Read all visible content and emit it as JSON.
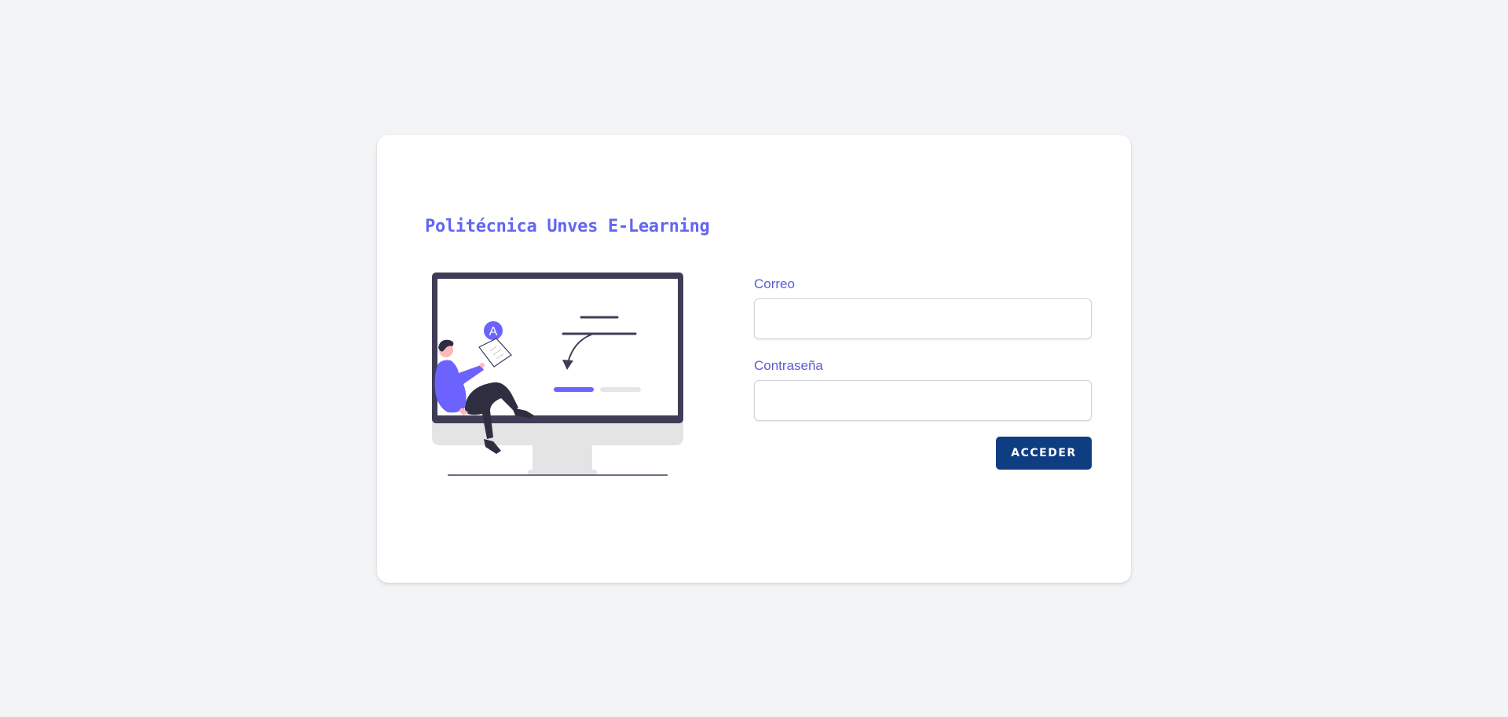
{
  "brand": {
    "title": "Politécnica Unves E-Learning"
  },
  "illustration": {
    "name": "online-learning-illustration",
    "badge_letter": "A"
  },
  "form": {
    "email_label": "Correo",
    "email_value": "",
    "password_label": "Contraseña",
    "password_value": "",
    "submit_label": "ACCEDER"
  },
  "colors": {
    "page_background": "#f3f4f6",
    "accent": "#6366f1",
    "button": "#0f3d82",
    "monitor_frame": "#3f3d56"
  }
}
